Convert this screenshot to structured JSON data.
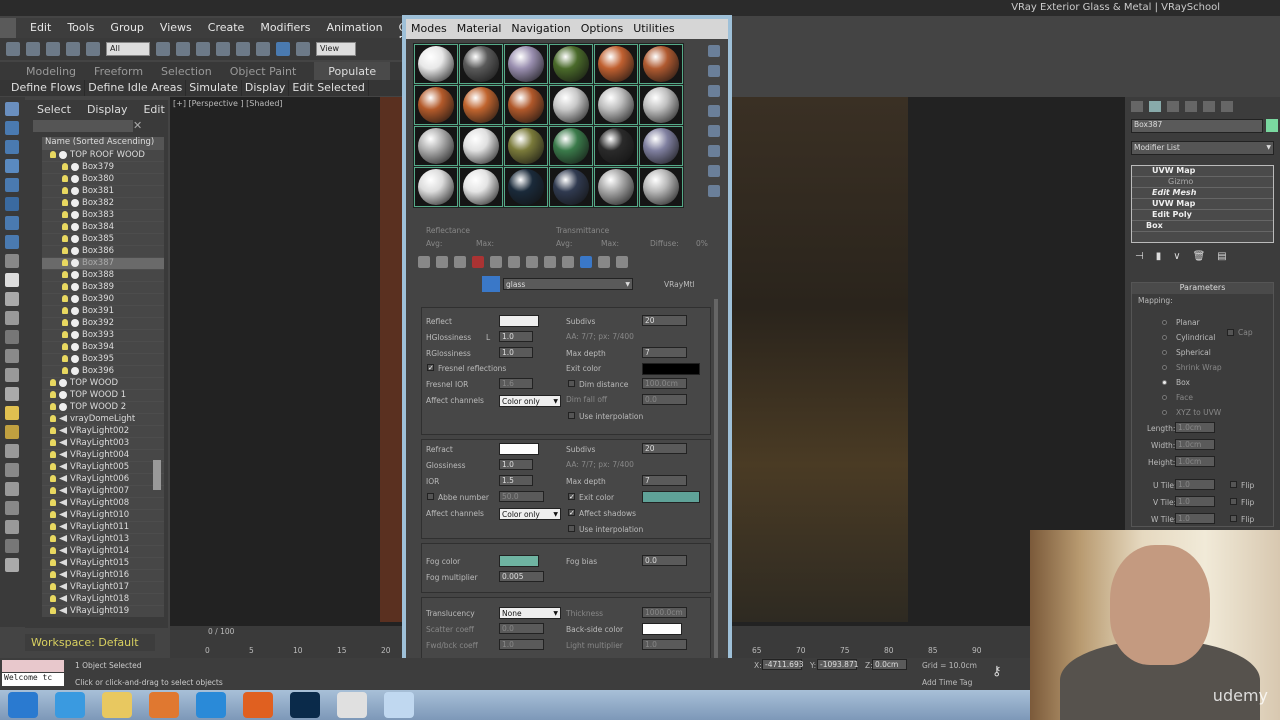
{
  "window": {
    "title": "VRay Exterior Glass & Metal | VRaySchool"
  },
  "menu": [
    "Edit",
    "Tools",
    "Group",
    "Views",
    "Create",
    "Modifiers",
    "Animation",
    "Graph E"
  ],
  "toolbar": {
    "selection_filter": "All",
    "ref_coord": "View"
  },
  "ribbon": {
    "tabs": [
      "Modeling",
      "Freeform",
      "Selection",
      "Object Paint",
      "Populate"
    ],
    "active": "Populate",
    "subtabs": [
      "Define Flows",
      "Define Idle Areas",
      "Simulate",
      "Display",
      "Edit Selected"
    ]
  },
  "explorer": {
    "tabs": [
      "Select",
      "Display",
      "Edit"
    ],
    "column": "Name (Sorted Ascending)",
    "rows": [
      {
        "name": "TOP ROOF WOOD",
        "type": "group",
        "level": 0
      },
      {
        "name": "Box379",
        "type": "box",
        "level": 1
      },
      {
        "name": "Box380",
        "type": "box",
        "level": 1
      },
      {
        "name": "Box381",
        "type": "box",
        "level": 1
      },
      {
        "name": "Box382",
        "type": "box",
        "level": 1
      },
      {
        "name": "Box383",
        "type": "box",
        "level": 1
      },
      {
        "name": "Box384",
        "type": "box",
        "level": 1
      },
      {
        "name": "Box385",
        "type": "box",
        "level": 1
      },
      {
        "name": "Box386",
        "type": "box",
        "level": 1
      },
      {
        "name": "Box387",
        "type": "box",
        "level": 1,
        "selected": true
      },
      {
        "name": "Box388",
        "type": "box",
        "level": 1
      },
      {
        "name": "Box389",
        "type": "box",
        "level": 1
      },
      {
        "name": "Box390",
        "type": "box",
        "level": 1
      },
      {
        "name": "Box391",
        "type": "box",
        "level": 1
      },
      {
        "name": "Box392",
        "type": "box",
        "level": 1
      },
      {
        "name": "Box393",
        "type": "box",
        "level": 1
      },
      {
        "name": "Box394",
        "type": "box",
        "level": 1
      },
      {
        "name": "Box395",
        "type": "box",
        "level": 1
      },
      {
        "name": "Box396",
        "type": "box",
        "level": 1
      },
      {
        "name": "TOP WOOD",
        "type": "group",
        "level": 0
      },
      {
        "name": "TOP WOOD 1",
        "type": "group",
        "level": 0
      },
      {
        "name": "TOP WOOD 2",
        "type": "group",
        "level": 0
      },
      {
        "name": "vrayDomeLight",
        "type": "light",
        "level": 0
      },
      {
        "name": "VRayLight002",
        "type": "light",
        "level": 0
      },
      {
        "name": "VRayLight003",
        "type": "light",
        "level": 0
      },
      {
        "name": "VRayLight004",
        "type": "light",
        "level": 0
      },
      {
        "name": "VRayLight005",
        "type": "light",
        "level": 0
      },
      {
        "name": "VRayLight006",
        "type": "light",
        "level": 0
      },
      {
        "name": "VRayLight007",
        "type": "light",
        "level": 0
      },
      {
        "name": "VRayLight008",
        "type": "light",
        "level": 0
      },
      {
        "name": "VRayLight010",
        "type": "light",
        "level": 0
      },
      {
        "name": "VRayLight011",
        "type": "light",
        "level": 0
      },
      {
        "name": "VRayLight013",
        "type": "light",
        "level": 0
      },
      {
        "name": "VRayLight014",
        "type": "light",
        "level": 0
      },
      {
        "name": "VRayLight015",
        "type": "light",
        "level": 0
      },
      {
        "name": "VRayLight016",
        "type": "light",
        "level": 0
      },
      {
        "name": "VRayLight017",
        "type": "light",
        "level": 0
      },
      {
        "name": "VRayLight018",
        "type": "light",
        "level": 0
      },
      {
        "name": "VRayLight019",
        "type": "light",
        "level": 0
      }
    ]
  },
  "viewport": {
    "label": "[+] [Perspective ] [Shaded]"
  },
  "material_editor": {
    "menu": [
      "Modes",
      "Material",
      "Navigation",
      "Options",
      "Utilities"
    ],
    "sphere_colors": [
      "#e8e8e8",
      "#5a5a5a",
      "#9a8fb0",
      "#4a6a2a",
      "#c06030",
      "#b05a30",
      "#b35a2a",
      "#c0642e",
      "#b0582a",
      "#c8c8c8",
      "#bdbdbd",
      "#c0c0c0",
      "#b0b0b0",
      "#e0e0e0",
      "#7a7a3a",
      "#3a7a4a",
      "#2a2a2a",
      "#8080a0",
      "#dcdcdc",
      "#e4e4e4",
      "#1a2a3a",
      "#303a50",
      "#a8a8a8",
      "#b8b8b8"
    ],
    "info": {
      "reflectance": "Reflectance",
      "transmittance": "Transmittance",
      "avg": "Avg:",
      "max": "Max:",
      "diffuse": "Diffuse:",
      "diffuse_val": "0%"
    },
    "material_name": "glass",
    "material_type": "VRayMtl",
    "reflect": {
      "label": "Reflect",
      "color": "#eeeeee",
      "hgloss_label": "HGlossiness",
      "hgloss": "1.0",
      "rgloss_label": "RGlossiness",
      "rgloss": "1.0",
      "fresnel_label": "Fresnel reflections",
      "fresnel_ior_label": "Fresnel IOR",
      "fresnel_ior": "1.6",
      "affect_label": "Affect channels",
      "affect": "Color only",
      "subdivs_label": "Subdivs",
      "subdivs": "20",
      "aa": "AA: 7/7; px: 7/400",
      "maxdepth_label": "Max depth",
      "maxdepth": "7",
      "exit_label": "Exit color",
      "exit_color": "#000000",
      "dim_label": "Dim distance",
      "dim": "100.0cm",
      "dimfall_label": "Dim fall off",
      "dimfall": "0.0",
      "interp_label": "Use interpolation",
      "lock": "L"
    },
    "refract": {
      "label": "Refract",
      "color": "#ffffff",
      "gloss_label": "Glossiness",
      "gloss": "1.0",
      "ior_label": "IOR",
      "ior": "1.5",
      "abbe_label": "Abbe number",
      "abbe": "50.0",
      "affect_label": "Affect channels",
      "affect": "Color only",
      "subdivs_label": "Subdivs",
      "subdivs": "20",
      "aa": "AA: 7/7; px: 7/400",
      "maxdepth_label": "Max depth",
      "maxdepth": "7",
      "exit_label": "Exit color",
      "exit_color": "#5fa298",
      "shadows_label": "Affect shadows",
      "interp_label": "Use interpolation"
    },
    "fog": {
      "color_label": "Fog color",
      "color": "#6fb4a2",
      "mult_label": "Fog multiplier",
      "mult": "0.005",
      "bias_label": "Fog bias",
      "bias": "0.0"
    },
    "translucency": {
      "label": "Translucency",
      "value": "None",
      "scatter_label": "Scatter coeff",
      "scatter": "0.0",
      "fwd_label": "Fwd/bck coeff",
      "fwd": "1.0",
      "thick_label": "Thickness",
      "thick": "1000.0cm",
      "back_label": "Back-side color",
      "back_color": "#ffffff",
      "light_label": "Light multiplier",
      "light": "1.0"
    }
  },
  "command_panel": {
    "object_name": "Box387",
    "object_color": "#7ad8a0",
    "modifier_list": "Modifier List",
    "stack": [
      "UVW Map",
      "Gizmo",
      "Edit Mesh",
      "UVW Map",
      "Edit Poly",
      "Box"
    ],
    "rollout": "Parameters",
    "mapping_label": "Mapping:",
    "mapping": [
      "Planar",
      "Cylindrical",
      "Spherical",
      "Shrink Wrap",
      "Box",
      "Face",
      "XYZ to UVW"
    ],
    "mapping_selected": "Box",
    "cap": "Cap",
    "length_label": "Length:",
    "length": "1.0cm",
    "width_label": "Width:",
    "width": "1.0cm",
    "height_label": "Height:",
    "height": "1.0cm",
    "utile_label": "U Tile:",
    "utile": "1.0",
    "vtile_label": "V Tile:",
    "vtile": "1.0",
    "wtile_label": "W Tile:",
    "wtile": "1.0",
    "flip": "Flip"
  },
  "timeline": {
    "frame": "0 / 100",
    "ticks_left": [
      "0",
      "5",
      "10",
      "15",
      "20"
    ],
    "ticks_right": [
      "65",
      "70",
      "75",
      "80",
      "85",
      "90"
    ]
  },
  "workspace": "Workspace: Default",
  "status": {
    "selected": "1 Object Selected",
    "prompt": "Click or click-and-drag to select objects",
    "welcome": "Welcome tc",
    "x_label": "X:",
    "x": "-4711.693",
    "y_label": "Y:",
    "y": "-1093.871",
    "z_label": "Z:",
    "z": "0.0cm",
    "grid": "Grid = 10.0cm",
    "time_tag": "Add Time Tag"
  },
  "taskbar": [
    "Start",
    "Internet Explorer",
    "Explorer",
    "Media Player",
    "App",
    "Firefox",
    "Photoshop",
    "Chrome",
    "Program"
  ],
  "watermark": "udemy"
}
